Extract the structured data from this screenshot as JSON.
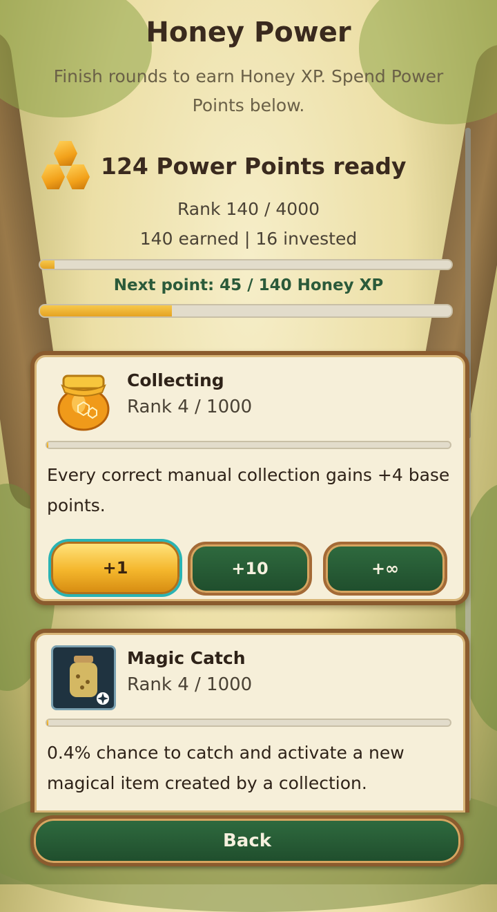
{
  "header": {
    "title": "Honey Power",
    "subtitle": "Finish rounds to earn Honey XP. Spend Power Points below."
  },
  "summary": {
    "power_points": "124 Power Points ready",
    "rank": "Rank 140 / 4000",
    "earned_invested": "140 earned | 16 invested",
    "rank_progress": 0.035,
    "next_point": "Next point: 45 / 140 Honey XP",
    "xp_progress": 0.32
  },
  "upgrades": [
    {
      "name": "Collecting",
      "rank": "Rank 4 / 1000",
      "progress": 0.004,
      "description": "Every correct manual collection gains +4 base points.",
      "icon": "honey-jar-icon",
      "buttons": [
        "+1",
        "+10",
        "+∞"
      ]
    },
    {
      "name": "Magic Catch",
      "rank": "Rank 4 / 1000",
      "progress": 0.004,
      "description": "0.4% chance to catch and activate a new magical item created by a collection.",
      "icon": "magic-jar-icon"
    }
  ],
  "footer": {
    "back_label": "Back"
  },
  "colors": {
    "gold": "#f4b62c",
    "green": "#1f4d2c",
    "wood": "#8a5b2e",
    "accent_teal": "#2ab3b3"
  }
}
